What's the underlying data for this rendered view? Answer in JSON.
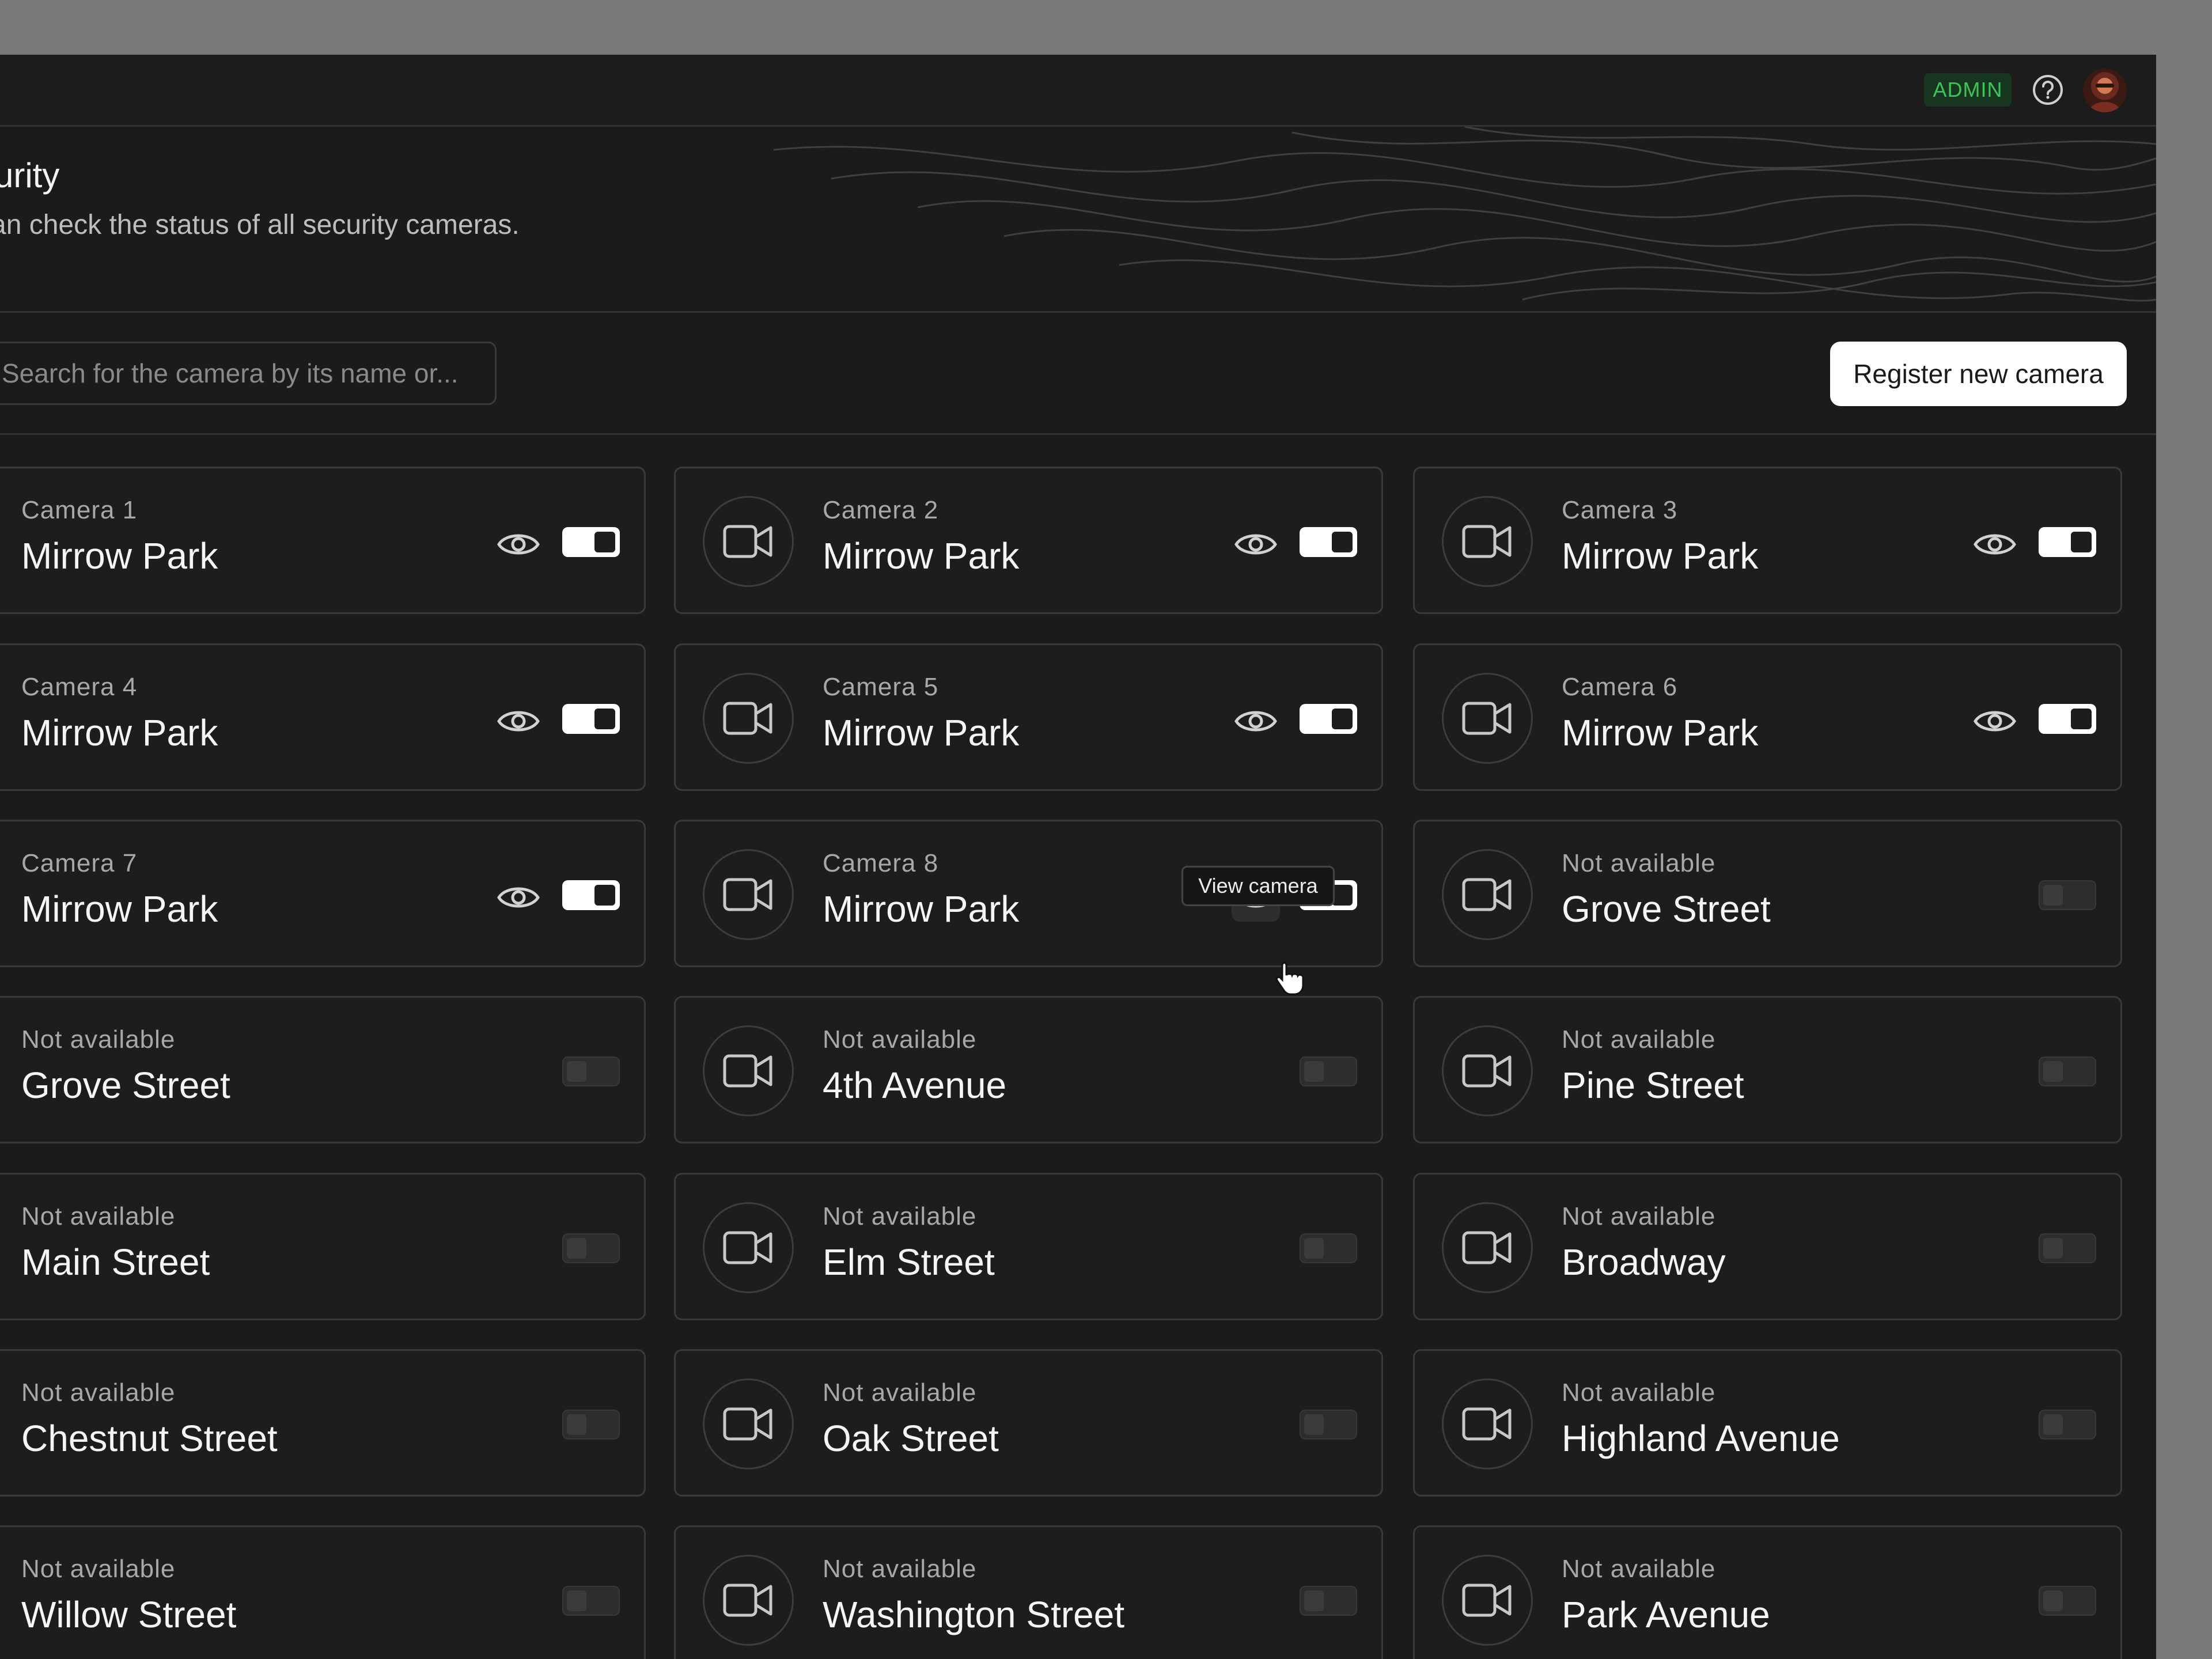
{
  "header": {
    "role_badge": "ADMIN",
    "help_icon": "help-circle-icon",
    "avatar_alt": "user avatar"
  },
  "page": {
    "title": "curity",
    "subtitle": "can check the status of all security cameras."
  },
  "toolbar": {
    "search_placeholder": "Search for the camera by its name or...",
    "search_value": "",
    "register_label": "Register new camera"
  },
  "tooltip": {
    "text": "View camera"
  },
  "icons": {
    "camera": "video-camera-icon",
    "eye": "eye-icon",
    "toggle": "toggle-switch"
  },
  "colors": {
    "background": "#1b1b1b",
    "border": "#3a3a3a",
    "admin_badge_bg": "#17361f",
    "admin_badge_text": "#3ec25a",
    "toggle_on": "#ffffff",
    "toggle_off": "#2d2d2d"
  },
  "cameras": [
    {
      "label": "Camera 1",
      "location": "Mirrow Park",
      "available": true,
      "enabled": true
    },
    {
      "label": "Camera 2",
      "location": "Mirrow Park",
      "available": true,
      "enabled": true
    },
    {
      "label": "Camera 3",
      "location": "Mirrow Park",
      "available": true,
      "enabled": true
    },
    {
      "label": "Camera 4",
      "location": "Mirrow Park",
      "available": true,
      "enabled": true
    },
    {
      "label": "Camera 5",
      "location": "Mirrow Park",
      "available": true,
      "enabled": true
    },
    {
      "label": "Camera 6",
      "location": "Mirrow Park",
      "available": true,
      "enabled": true
    },
    {
      "label": "Camera 7",
      "location": "Mirrow Park",
      "available": true,
      "enabled": true
    },
    {
      "label": "Camera 8",
      "location": "Mirrow Park",
      "available": true,
      "enabled": true,
      "hovered": true
    },
    {
      "label": "Not available",
      "location": "Grove Street",
      "available": false,
      "enabled": false
    },
    {
      "label": "Not available",
      "location": "Grove Street",
      "available": false,
      "enabled": false
    },
    {
      "label": "Not available",
      "location": "4th Avenue",
      "available": false,
      "enabled": false
    },
    {
      "label": "Not available",
      "location": "Pine Street",
      "available": false,
      "enabled": false
    },
    {
      "label": "Not available",
      "location": "Main Street",
      "available": false,
      "enabled": false
    },
    {
      "label": "Not available",
      "location": "Elm Street",
      "available": false,
      "enabled": false
    },
    {
      "label": "Not available",
      "location": "Broadway",
      "available": false,
      "enabled": false
    },
    {
      "label": "Not available",
      "location": "Chestnut Street",
      "available": false,
      "enabled": false
    },
    {
      "label": "Not available",
      "location": "Oak Street",
      "available": false,
      "enabled": false
    },
    {
      "label": "Not available",
      "location": "Highland Avenue",
      "available": false,
      "enabled": false
    },
    {
      "label": "Not available",
      "location": "Willow Street",
      "available": false,
      "enabled": false
    },
    {
      "label": "Not available",
      "location": "Washington Street",
      "available": false,
      "enabled": false
    },
    {
      "label": "Not available",
      "location": "Park Avenue",
      "available": false,
      "enabled": false
    }
  ]
}
